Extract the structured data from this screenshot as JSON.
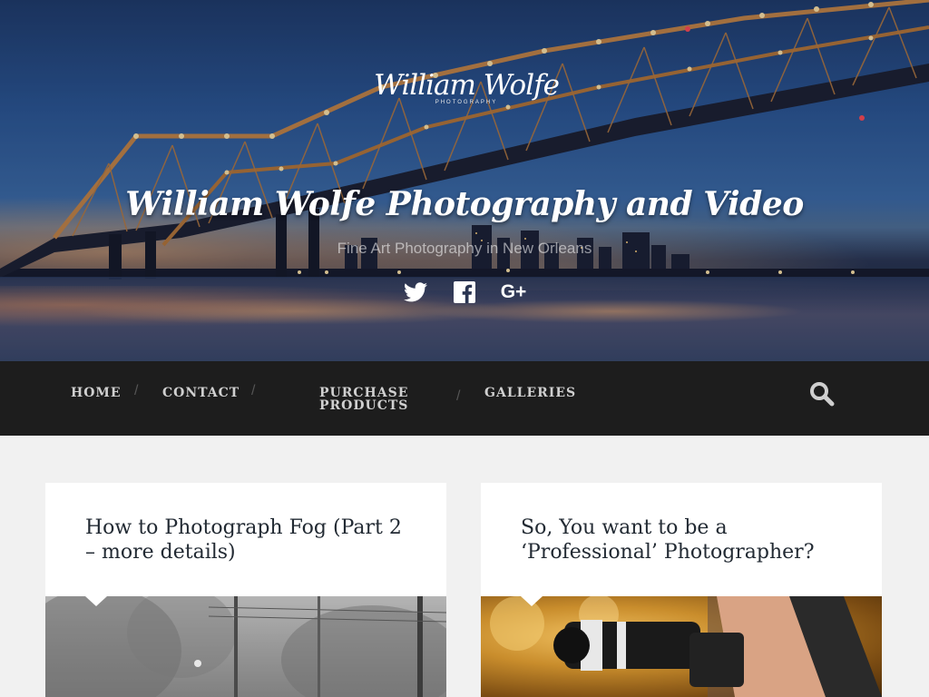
{
  "site": {
    "logo_text": "William Wolfe",
    "logo_subtext": "PHOTOGRAPHY",
    "title": "William Wolfe Photography and Video",
    "description": "Fine Art Photography in New Orleans"
  },
  "social": [
    {
      "name": "twitter-icon",
      "label": "Twitter"
    },
    {
      "name": "facebook-icon",
      "label": "Facebook"
    },
    {
      "name": "google-plus-icon",
      "label": "G+"
    }
  ],
  "nav": {
    "items": [
      {
        "label": "HOME"
      },
      {
        "label": "CONTACT"
      },
      {
        "label": "PURCHASE PRODUCTS"
      },
      {
        "label": "GALLERIES"
      }
    ],
    "search_icon": "search-icon"
  },
  "posts": [
    {
      "title": "How to Photograph Fog (Part 2 – more details)",
      "image": "foggy-street-photo"
    },
    {
      "title": "So, You want to be a ‘Professional’ Photographer?",
      "image": "photographer-with-camera-photo"
    }
  ],
  "colors": {
    "nav_bg": "#1d1d1d",
    "nav_text": "#d0d0d0",
    "page_bg": "#f1f1f1",
    "card_title": "#222a33"
  }
}
